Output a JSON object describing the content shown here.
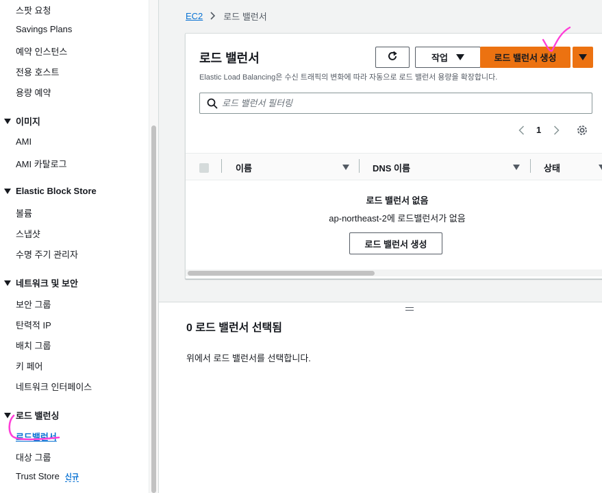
{
  "sidebar": {
    "items_top": [
      "스팟 요청",
      "Savings Plans",
      "예약 인스턴스",
      "전용 호스트",
      "용량 예약"
    ],
    "sections": [
      {
        "title": "이미지",
        "items": [
          "AMI",
          "AMI 카탈로그"
        ]
      },
      {
        "title": "Elastic Block Store",
        "items": [
          "볼륨",
          "스냅샷",
          "수명 주기 관리자"
        ]
      },
      {
        "title": "네트워크 및 보안",
        "items": [
          "보안 그룹",
          "탄력적 IP",
          "배치 그룹",
          "키 페어",
          "네트워크 인터페이스"
        ]
      },
      {
        "title": "로드 밸런싱",
        "items": [
          "로드밸런서",
          "대상 그룹",
          "Trust Store"
        ],
        "new_badge": "신규"
      }
    ]
  },
  "breadcrumb": {
    "root": "EC2",
    "current": "로드 밸런서"
  },
  "panel": {
    "title": "로드 밸런서",
    "description": "Elastic Load Balancing은 수신 트래픽의 변화에 따라 자동으로 로드 밸런서 용량을 확장합니다.",
    "actions_label": "작업",
    "create_label": "로드 밸런서 생성",
    "search_placeholder": "로드 밸런서 필터링",
    "page_number": "1",
    "columns": [
      "이름",
      "DNS 이름",
      "상태"
    ],
    "empty_title": "로드 밸런서 없음",
    "empty_subtitle": "ap-northeast-2에 로드밸런서가 없음",
    "empty_button": "로드 밸런서 생성"
  },
  "details": {
    "title": "0 로드 밸런서 선택됨",
    "text": "위에서 로드 밸런서를 선택합니다."
  },
  "colors": {
    "primary": "#ec7211",
    "link": "#0972d3",
    "annotation": "#ff3fd8"
  }
}
